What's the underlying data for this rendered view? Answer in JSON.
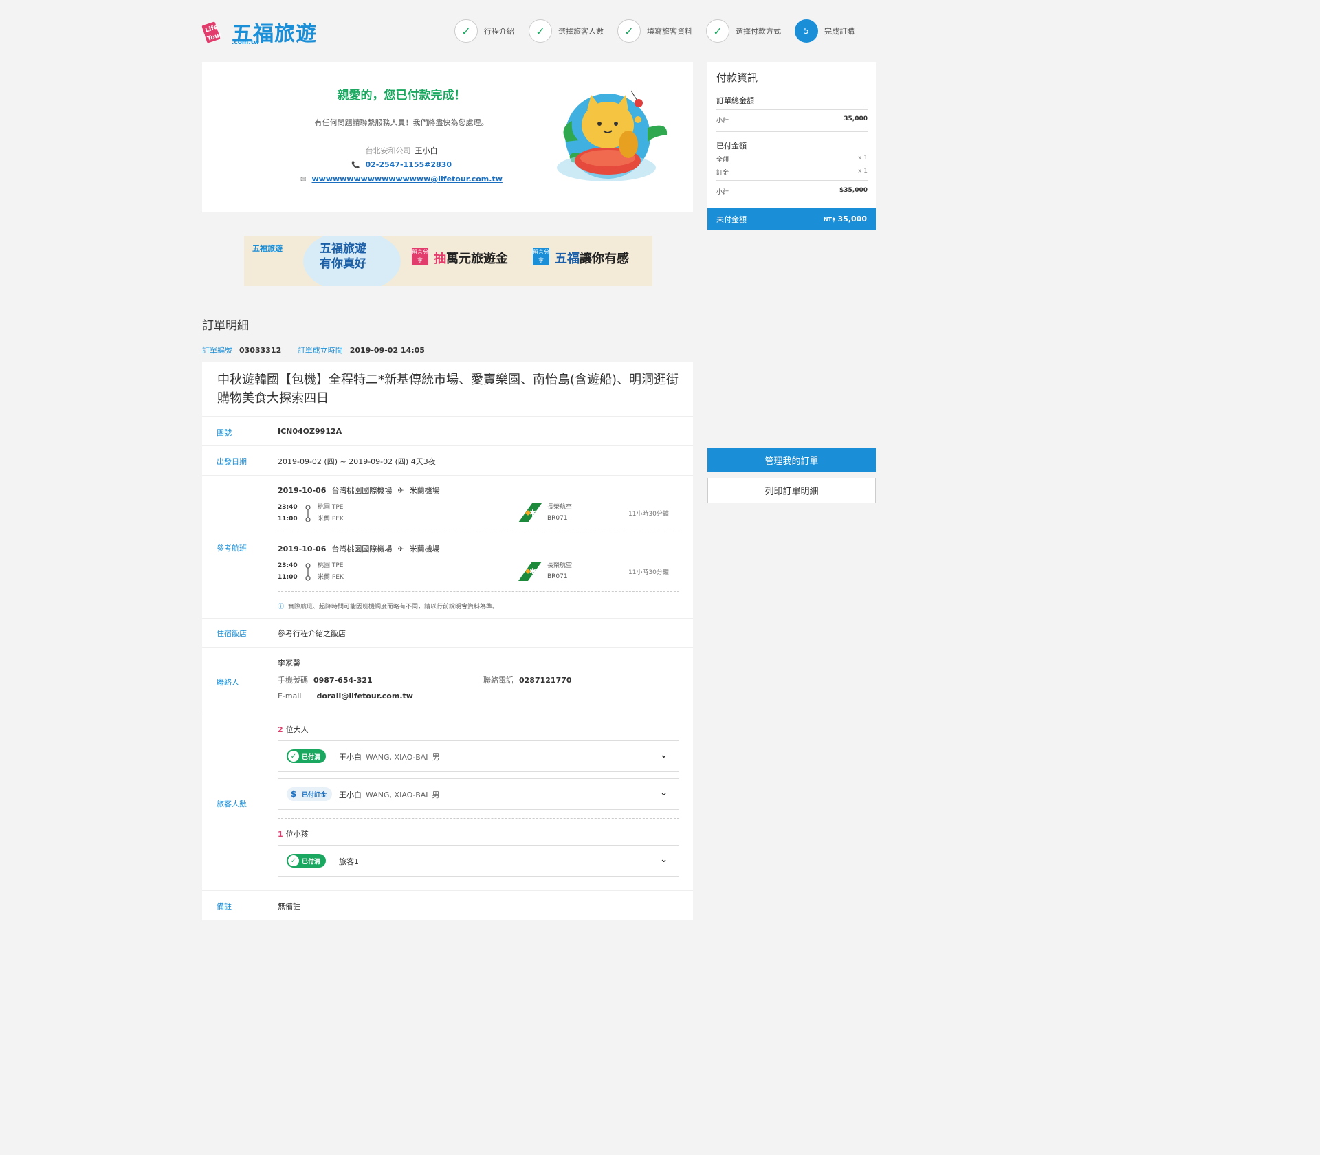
{
  "brand": {
    "name": "五福旅遊",
    "domain": ".com.tw",
    "badge_text": "Life Tour"
  },
  "steps": [
    {
      "label": "行程介紹",
      "done": true
    },
    {
      "label": "選擇旅客人數",
      "done": true
    },
    {
      "label": "填寫旅客資料",
      "done": true
    },
    {
      "label": "選擇付款方式",
      "done": true
    },
    {
      "label": "完成訂購",
      "number": "5",
      "active": true
    }
  ],
  "success": {
    "title": "親愛的，您已付款完成！",
    "message": "有任何問題請聯繫服務人員！我們將盡快為您處理。",
    "company": "台北安和公司",
    "agent": "王小白",
    "phone": "02-2547-1155#2830",
    "email": "wwwwwwwwwwwwwwwww@lifetour.com.tw"
  },
  "payment": {
    "title": "付款資訊",
    "total_label": "訂單總金額",
    "total_subtotal_label": "小計",
    "total_subtotal_value": "35,000",
    "paid_label": "已付金額",
    "paid_items": [
      {
        "label": "全額",
        "qty": "x 1"
      },
      {
        "label": "訂金",
        "qty": "x 1"
      }
    ],
    "paid_subtotal_label": "小計",
    "paid_subtotal_value": "$35,000",
    "unpaid_label": "未付金額",
    "unpaid_currency": "NT$",
    "unpaid_value": "35,000"
  },
  "banner": {
    "logo": "五福旅遊",
    "hand_line1": "五福旅遊",
    "hand_line2": "有你真好",
    "tag1": "留言分享",
    "text1_red": "抽",
    "text1": "萬元旅遊金",
    "tag2": "留言分享",
    "text2_blue": "五福",
    "text2": "讓你有感"
  },
  "order": {
    "section_title": "訂單明細",
    "number_label": "訂單編號",
    "number": "03033312",
    "created_label": "訂單成立時間",
    "created": "2019-09-02 14:05",
    "tour_name": "中秋遊韓國【包機】全程特二*新基傳統市場、愛寶樂園、南怡島(含遊船)、明洞逛街購物美食大探索四日",
    "group_label": "團號",
    "group": "ICN04OZ9912A",
    "depart_label": "出發日期",
    "depart": "2019-09-02 (四) ~ 2019-09-02 (四) 4天3夜",
    "flight_label": "參考航班",
    "flights": [
      {
        "date": "2019-10-06",
        "from": "台灣桃園國際機場",
        "to": "米蘭機場",
        "dep_time": "23:40",
        "dep_airport": "桃園 TPE",
        "arr_time": "11:00",
        "arr_airport": "米蘭 PEK",
        "airline": "長榮航空",
        "flight_no": "BR071",
        "duration": "11小時30分鐘"
      },
      {
        "date": "2019-10-06",
        "from": "台灣桃園國際機場",
        "to": "米蘭機場",
        "dep_time": "23:40",
        "dep_airport": "桃園 TPE",
        "arr_time": "11:00",
        "arr_airport": "米蘭 PEK",
        "airline": "長榮航空",
        "flight_no": "BR071",
        "duration": "11小時30分鐘"
      }
    ],
    "flight_note": "實際航班、起降時間可能因班機調度而略有不同，請以行前說明會資料為準。",
    "hotel_label": "住宿飯店",
    "hotel": "參考行程介紹之飯店",
    "contact_label": "聯絡人",
    "contact_name": "李家馨",
    "mobile_label": "手機號碼",
    "mobile": "0987-654-321",
    "tel_label": "聯絡電話",
    "tel": "0287121770",
    "email_label": "E-mail",
    "email": "dorali@lifetour.com.tw",
    "pax_label": "旅客人數",
    "adult_count": "2",
    "adult_text": "位大人",
    "child_count": "1",
    "child_text": "位小孩",
    "passengers": [
      {
        "status": "已付清",
        "name": "王小白",
        "en": "WANG, XIAO-BAI",
        "gender": "男"
      },
      {
        "status": "已付訂金",
        "name": "王小白",
        "en": "WANG, XIAO-BAI",
        "gender": "男"
      },
      {
        "status": "已付清",
        "name": "旅客1"
      }
    ],
    "remark_label": "備註",
    "remark": "無備註"
  },
  "actions": {
    "manage": "管理我的訂單",
    "print": "列印訂單明細"
  },
  "colors": {
    "brand_blue": "#1a8fd8",
    "success_green": "#1aa860",
    "accent_pink": "#e23c6c"
  }
}
